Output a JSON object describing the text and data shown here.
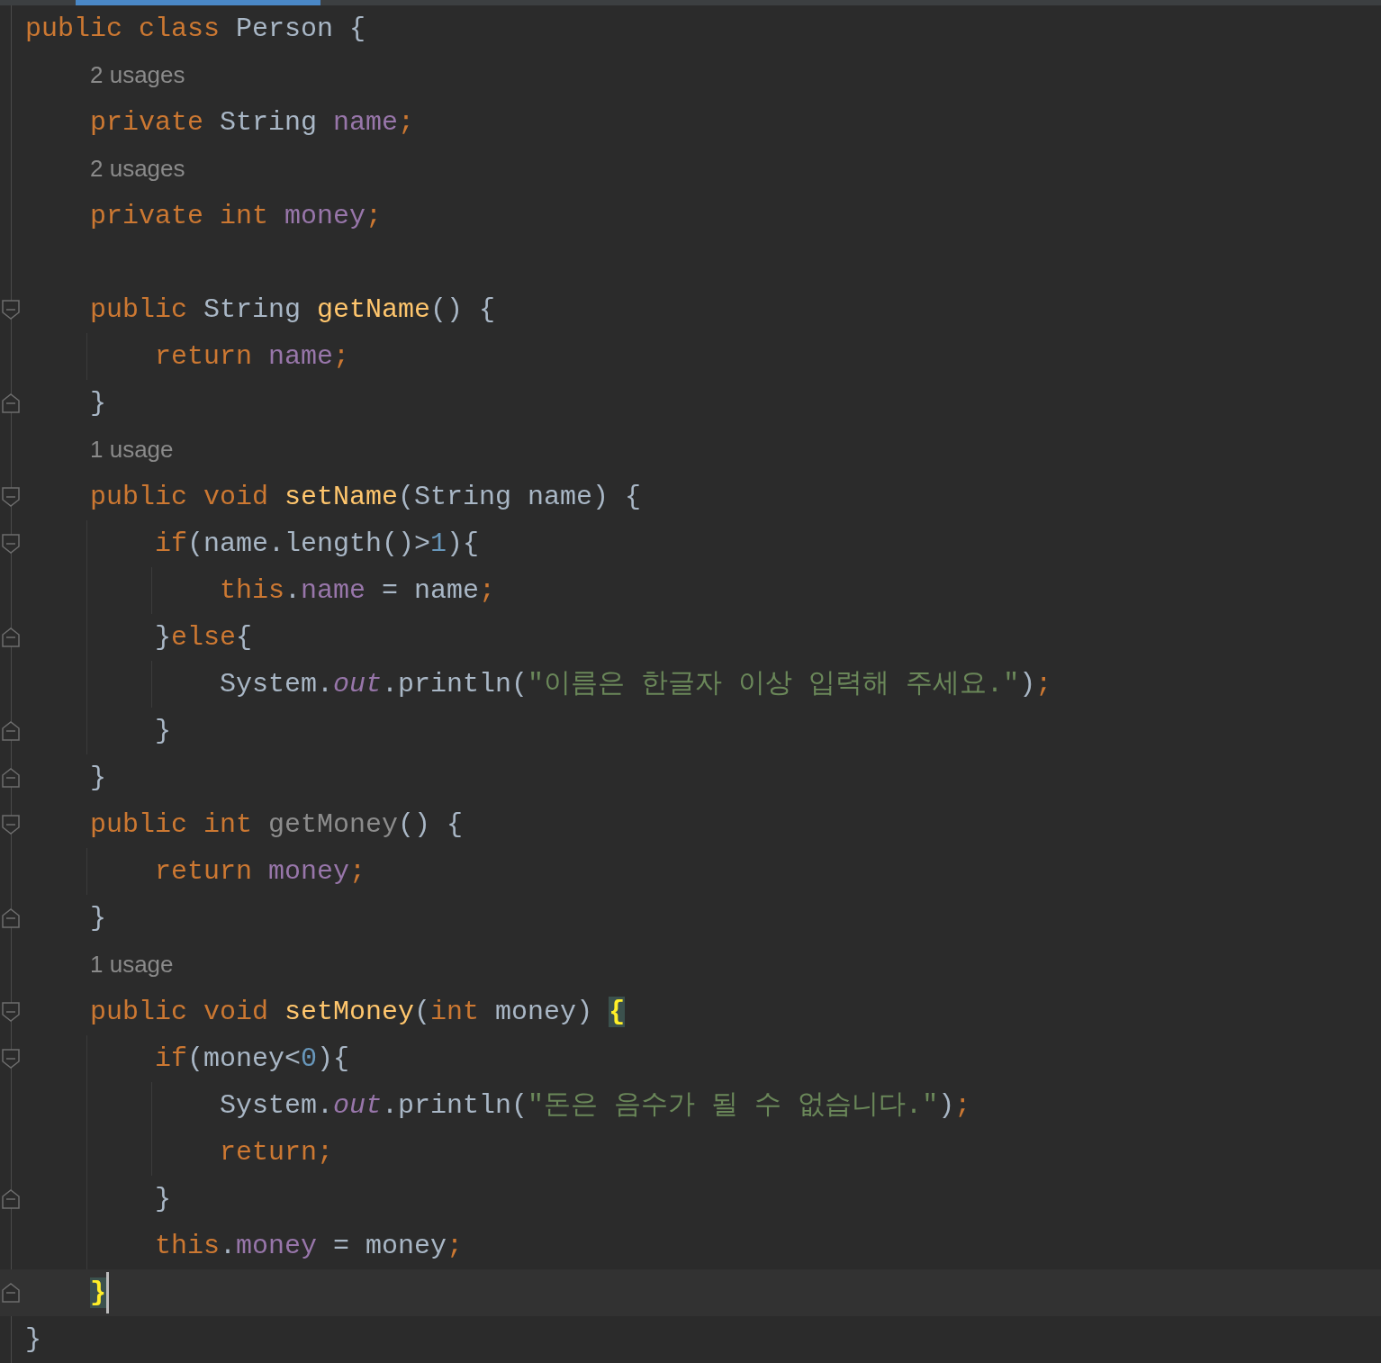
{
  "editor": {
    "lines": [
      {
        "kind": "code",
        "fold_open": false,
        "fold_close": false,
        "current": false,
        "caret": false,
        "tokens": [
          {
            "kind": "keyword",
            "text": "public class"
          },
          {
            "kind": "plain",
            "text": " Person {"
          }
        ]
      },
      {
        "kind": "hint",
        "fold_open": false,
        "fold_close": false,
        "current": false,
        "caret": false,
        "text": "    2 usages"
      },
      {
        "kind": "code",
        "fold_open": false,
        "fold_close": false,
        "current": false,
        "caret": false,
        "tokens": [
          {
            "kind": "keyword",
            "text": "    private"
          },
          {
            "kind": "plain",
            "text": " String "
          },
          {
            "kind": "field",
            "text": "name"
          },
          {
            "kind": "keyword",
            "text": ";"
          }
        ]
      },
      {
        "kind": "hint",
        "fold_open": false,
        "fold_close": false,
        "current": false,
        "caret": false,
        "text": "    2 usages"
      },
      {
        "kind": "code",
        "fold_open": false,
        "fold_close": false,
        "current": false,
        "caret": false,
        "tokens": [
          {
            "kind": "keyword",
            "text": "    private int"
          },
          {
            "kind": "field",
            "text": " money"
          },
          {
            "kind": "keyword",
            "text": ";"
          }
        ]
      },
      {
        "kind": "blank",
        "fold_open": false,
        "fold_close": false,
        "current": false,
        "caret": false
      },
      {
        "kind": "code",
        "fold_open": true,
        "fold_close": false,
        "current": false,
        "caret": false,
        "tokens": [
          {
            "kind": "keyword",
            "text": "    public"
          },
          {
            "kind": "plain",
            "text": " String "
          },
          {
            "kind": "method",
            "text": "getName"
          },
          {
            "kind": "plain",
            "text": "() {"
          }
        ]
      },
      {
        "kind": "code",
        "fold_open": false,
        "fold_close": false,
        "current": false,
        "caret": false,
        "tokens": [
          {
            "kind": "keyword",
            "text": "        return"
          },
          {
            "kind": "field",
            "text": " name"
          },
          {
            "kind": "keyword",
            "text": ";"
          }
        ]
      },
      {
        "kind": "code",
        "fold_open": false,
        "fold_close": true,
        "current": false,
        "caret": false,
        "tokens": [
          {
            "kind": "plain",
            "text": "    }"
          }
        ]
      },
      {
        "kind": "hint",
        "fold_open": false,
        "fold_close": false,
        "current": false,
        "caret": false,
        "text": "    1 usage"
      },
      {
        "kind": "code",
        "fold_open": true,
        "fold_close": false,
        "current": false,
        "caret": false,
        "tokens": [
          {
            "kind": "keyword",
            "text": "    public void"
          },
          {
            "kind": "method",
            "text": " setName"
          },
          {
            "kind": "plain",
            "text": "(String name) {"
          }
        ]
      },
      {
        "kind": "code",
        "fold_open": true,
        "fold_close": false,
        "current": false,
        "caret": false,
        "tokens": [
          {
            "kind": "keyword",
            "text": "        if"
          },
          {
            "kind": "plain",
            "text": "(name.length()>"
          },
          {
            "kind": "number",
            "text": "1"
          },
          {
            "kind": "plain",
            "text": "){"
          }
        ]
      },
      {
        "kind": "code",
        "fold_open": false,
        "fold_close": false,
        "current": false,
        "caret": false,
        "tokens": [
          {
            "kind": "keyword",
            "text": "            this"
          },
          {
            "kind": "plain",
            "text": "."
          },
          {
            "kind": "field",
            "text": "name"
          },
          {
            "kind": "plain",
            "text": " = name"
          },
          {
            "kind": "keyword",
            "text": ";"
          }
        ]
      },
      {
        "kind": "code",
        "fold_open": false,
        "fold_close": true,
        "current": false,
        "caret": false,
        "tokens": [
          {
            "kind": "plain",
            "text": "        }"
          },
          {
            "kind": "keyword",
            "text": "else"
          },
          {
            "kind": "plain",
            "text": "{"
          }
        ]
      },
      {
        "kind": "code",
        "fold_open": false,
        "fold_close": false,
        "current": false,
        "caret": false,
        "tokens": [
          {
            "kind": "plain",
            "text": "            System."
          },
          {
            "kind": "static",
            "text": "out"
          },
          {
            "kind": "plain",
            "text": ".println("
          },
          {
            "kind": "string",
            "text": "\"이름은 한글자 이상 입력해 주세요.\""
          },
          {
            "kind": "plain",
            "text": ")"
          },
          {
            "kind": "keyword",
            "text": ";"
          }
        ]
      },
      {
        "kind": "code",
        "fold_open": false,
        "fold_close": true,
        "current": false,
        "caret": false,
        "tokens": [
          {
            "kind": "plain",
            "text": "        }"
          }
        ]
      },
      {
        "kind": "code",
        "fold_open": false,
        "fold_close": true,
        "current": false,
        "caret": false,
        "tokens": [
          {
            "kind": "plain",
            "text": "    }"
          }
        ]
      },
      {
        "kind": "code",
        "fold_open": true,
        "fold_close": false,
        "current": false,
        "caret": false,
        "tokens": [
          {
            "kind": "keyword",
            "text": "    public int"
          },
          {
            "kind": "unused",
            "text": " getMoney"
          },
          {
            "kind": "plain",
            "text": "() {"
          }
        ]
      },
      {
        "kind": "code",
        "fold_open": false,
        "fold_close": false,
        "current": false,
        "caret": false,
        "tokens": [
          {
            "kind": "keyword",
            "text": "        return"
          },
          {
            "kind": "field",
            "text": " money"
          },
          {
            "kind": "keyword",
            "text": ";"
          }
        ]
      },
      {
        "kind": "code",
        "fold_open": false,
        "fold_close": true,
        "current": false,
        "caret": false,
        "tokens": [
          {
            "kind": "plain",
            "text": "    }"
          }
        ]
      },
      {
        "kind": "hint",
        "fold_open": false,
        "fold_close": false,
        "current": false,
        "caret": false,
        "text": "    1 usage"
      },
      {
        "kind": "code",
        "fold_open": true,
        "fold_close": false,
        "current": false,
        "caret": false,
        "tokens": [
          {
            "kind": "keyword",
            "text": "    public void"
          },
          {
            "kind": "method",
            "text": " setMoney"
          },
          {
            "kind": "plain",
            "text": "("
          },
          {
            "kind": "keyword",
            "text": "int"
          },
          {
            "kind": "plain",
            "text": " money) "
          },
          {
            "kind": "brace_match",
            "text": "{"
          }
        ]
      },
      {
        "kind": "code",
        "fold_open": true,
        "fold_close": false,
        "current": false,
        "caret": false,
        "tokens": [
          {
            "kind": "keyword",
            "text": "        if"
          },
          {
            "kind": "plain",
            "text": "(money<"
          },
          {
            "kind": "number",
            "text": "0"
          },
          {
            "kind": "plain",
            "text": "){"
          }
        ]
      },
      {
        "kind": "code",
        "fold_open": false,
        "fold_close": false,
        "current": false,
        "caret": false,
        "tokens": [
          {
            "kind": "plain",
            "text": "            System."
          },
          {
            "kind": "static",
            "text": "out"
          },
          {
            "kind": "plain",
            "text": ".println("
          },
          {
            "kind": "string",
            "text": "\"돈은 음수가 될 수 없습니다.\""
          },
          {
            "kind": "plain",
            "text": ")"
          },
          {
            "kind": "keyword",
            "text": ";"
          }
        ]
      },
      {
        "kind": "code",
        "fold_open": false,
        "fold_close": false,
        "current": false,
        "caret": false,
        "tokens": [
          {
            "kind": "keyword",
            "text": "            return;"
          }
        ]
      },
      {
        "kind": "code",
        "fold_open": false,
        "fold_close": true,
        "current": false,
        "caret": false,
        "tokens": [
          {
            "kind": "plain",
            "text": "        }"
          }
        ]
      },
      {
        "kind": "code",
        "fold_open": false,
        "fold_close": false,
        "current": false,
        "caret": false,
        "tokens": [
          {
            "kind": "keyword",
            "text": "        this"
          },
          {
            "kind": "plain",
            "text": "."
          },
          {
            "kind": "field",
            "text": "money"
          },
          {
            "kind": "plain",
            "text": " = money"
          },
          {
            "kind": "keyword",
            "text": ";"
          }
        ]
      },
      {
        "kind": "code",
        "fold_open": false,
        "fold_close": true,
        "current": true,
        "caret": true,
        "tokens": [
          {
            "kind": "brace_match",
            "text": "    }"
          }
        ]
      },
      {
        "kind": "code",
        "fold_open": false,
        "fold_close": false,
        "current": false,
        "caret": false,
        "tokens": [
          {
            "kind": "plain",
            "text": "}"
          }
        ]
      }
    ]
  }
}
